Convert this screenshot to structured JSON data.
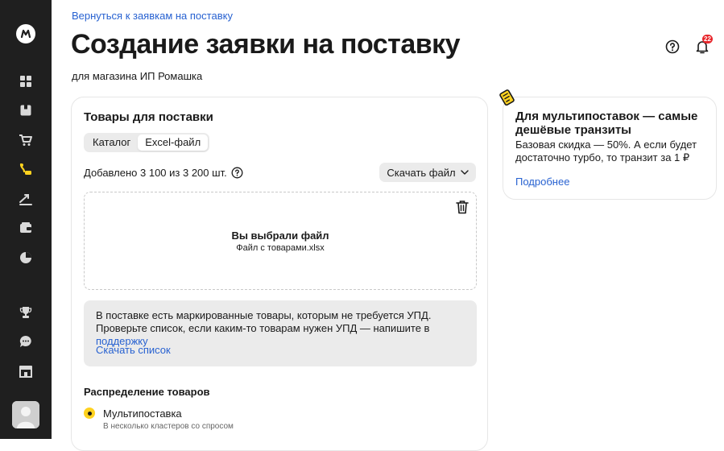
{
  "header": {
    "back_link": "Вернуться к заявкам на поставку",
    "title": "Создание заявки на поставку",
    "subtitle": "для магазина ИП Ромашка",
    "notifications_count": "22"
  },
  "sidebar": {
    "items": [
      {
        "icon": "dashboard-icon"
      },
      {
        "icon": "box-icon"
      },
      {
        "icon": "cart-icon"
      },
      {
        "icon": "supply-icon",
        "active": true
      },
      {
        "icon": "growth-icon"
      },
      {
        "icon": "wallet-icon"
      },
      {
        "icon": "pie-chart-icon"
      },
      {
        "icon": "trophy-icon"
      },
      {
        "icon": "chat-icon"
      },
      {
        "icon": "store-icon"
      }
    ]
  },
  "goods": {
    "title": "Товары для поставки",
    "tabs": [
      "Каталог",
      "Excel-файл"
    ],
    "active_tab": "Excel-файл",
    "added_text": "Добавлено 3 100 из 3 200 шт.",
    "download_button": "Скачать файл",
    "upload": {
      "title": "Вы выбрали файл",
      "file_name": "Файл с товарами.xlsx"
    },
    "notice": {
      "text": "В поставке есть маркированные товары, которым не требуется УПД. Проверьте список, если каким-то товарам нужен УПД — напишите в",
      "link": "поддержку",
      "action": "Скачать список"
    },
    "distribution": {
      "title": "Распределение товаров",
      "option_label": "Мультипоставка",
      "option_desc": "В несколько кластеров со спросом"
    }
  },
  "promo": {
    "title": "Для мультипоставок — самые дешёвые транзиты",
    "text": "Базовая скидка — 50%. А если будет достаточно турбо, то транзит за 1 ₽",
    "link": "Подробнее"
  },
  "colors": {
    "sidebar_bg": "#1f1f1f",
    "link": "#2862d1",
    "accent_yellow": "#ffd21f",
    "active_icon": "#ffd21f",
    "badge_red": "#e8262b"
  }
}
